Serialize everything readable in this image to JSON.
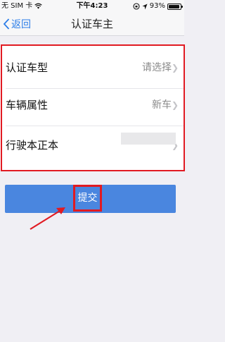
{
  "status_bar": {
    "carrier": "无 SIM 卡",
    "time": "下午4:23",
    "battery": "93%"
  },
  "nav": {
    "back_label": "返回",
    "title": "认证车主"
  },
  "form": {
    "rows": [
      {
        "label": "认证车型",
        "value": "请选择"
      },
      {
        "label": "车辆属性",
        "value": "新车"
      },
      {
        "label": "行驶本正本",
        "value": ""
      }
    ]
  },
  "submit": {
    "label": "提交"
  },
  "colors": {
    "accent": "#4a86df",
    "annotation": "#e11a22"
  }
}
